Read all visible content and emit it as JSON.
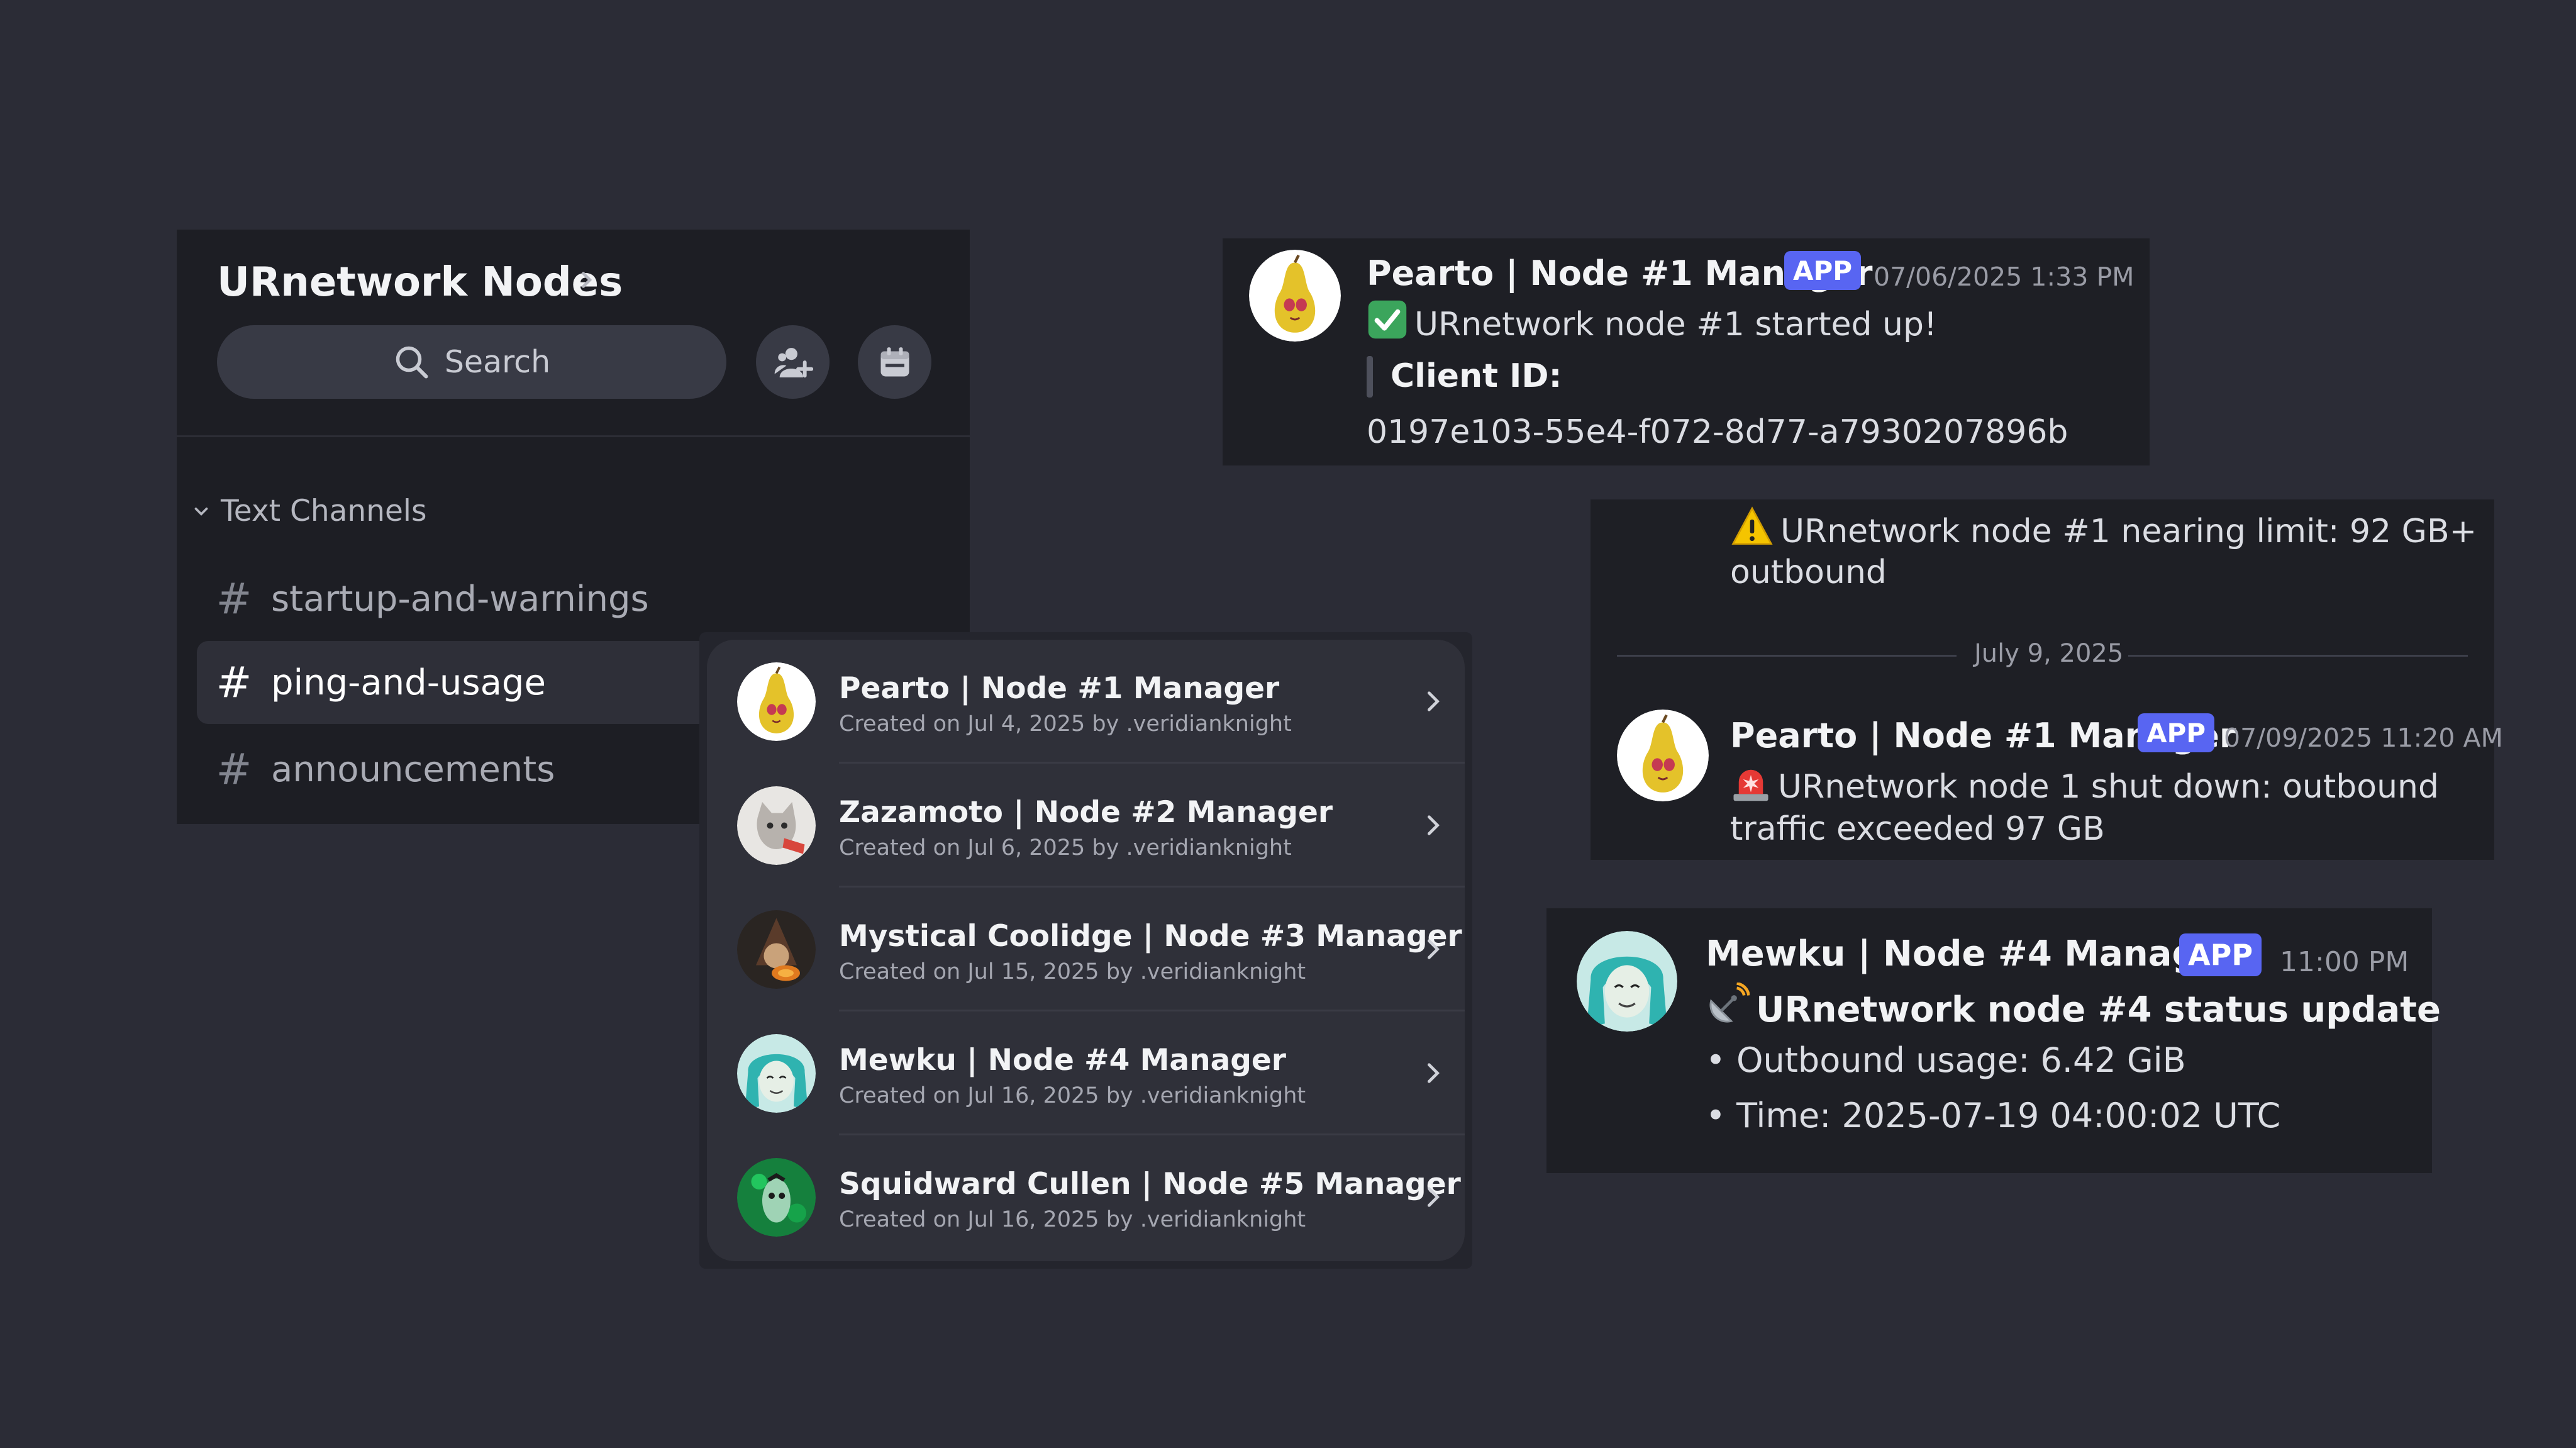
{
  "sidebar": {
    "server_name": "URnetwork Nodes",
    "search_label": "Search",
    "category": "Text Channels",
    "channels": [
      {
        "name": "startup-and-warnings",
        "active": false
      },
      {
        "name": "ping-and-usage",
        "active": true
      },
      {
        "name": "announcements",
        "active": false
      }
    ]
  },
  "bots": [
    {
      "name": "Pearto | Node #1 Manager",
      "meta": "Created on Jul 4, 2025 by .veridianknight",
      "avatar": "pear-avatar"
    },
    {
      "name": "Zazamoto | Node #2 Manager",
      "meta": "Created on Jul 6, 2025 by .veridianknight",
      "avatar": "cat-avatar"
    },
    {
      "name": "Mystical Coolidge | Node #3 Manager",
      "meta": "Created on Jul 15, 2025 by .veridianknight",
      "avatar": "wizard-avatar"
    },
    {
      "name": "Mewku | Node #4 Manager",
      "meta": "Created on Jul 16, 2025 by .veridianknight",
      "avatar": "teal-hair-avatar"
    },
    {
      "name": "Squidward Cullen | Node #5 Manager",
      "meta": "Created on Jul 16, 2025 by .veridianknight",
      "avatar": "green-avatar"
    }
  ],
  "messages": {
    "m1": {
      "author": "Pearto | Node #1 Manager",
      "badge": "APP",
      "timestamp": "07/06/2025 1:33 PM",
      "line1": "URnetwork node #1 started up!",
      "quote_label": "Client ID:",
      "client_id": "0197e103-55e4-f072-8d77-a7930207896b"
    },
    "m2": {
      "warning_line1": "URnetwork node #1 nearing limit: 92 GB+",
      "warning_line2": "outbound",
      "date_divider": "July 9, 2025",
      "author": "Pearto | Node #1 Manager",
      "badge": "APP",
      "timestamp": "07/09/2025 11:20 AM",
      "line1": "URnetwork node 1 shut down: outbound",
      "line2": "traffic exceeded 97 GB"
    },
    "m3": {
      "author": "Mewku | Node #4 Manager",
      "badge": "APP",
      "timestamp": "11:00 PM",
      "heading": "URnetwork node #4 status update",
      "bullet1": "• Outbound usage: 6.42 GiB",
      "bullet2": "• Time: 2025-07-19 04:00:02 UTC"
    }
  },
  "colors": {
    "background": "#2b2c36",
    "panel": "#1e1f25",
    "badge": "#5865f2",
    "check": "#3ba55c",
    "warning": "#f5c400",
    "siren": "#e53935"
  }
}
